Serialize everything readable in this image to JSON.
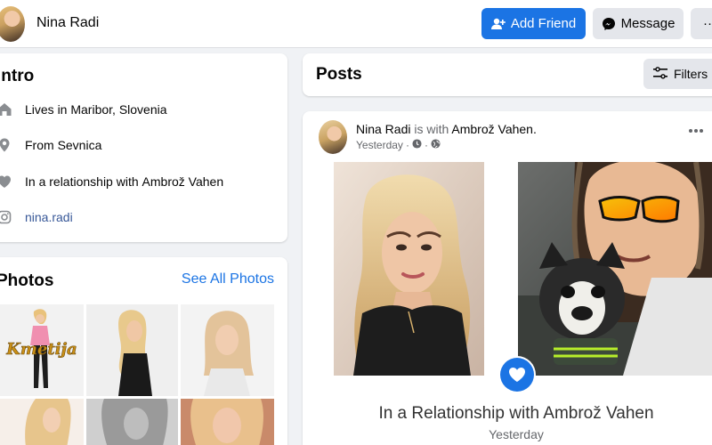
{
  "header": {
    "name": "Nina Radi",
    "add_friend_label": "Add Friend",
    "message_label": "Message",
    "more_label": "···"
  },
  "intro": {
    "title": "Intro",
    "items": [
      {
        "icon": "home-icon",
        "prefix": "Lives in ",
        "value": "Maribor, Slovenia"
      },
      {
        "icon": "location-pin-icon",
        "prefix": "From ",
        "value": "Sevnica"
      },
      {
        "icon": "heart-icon",
        "prefix": "In a relationship with ",
        "value": "Ambrož Vahen"
      },
      {
        "icon": "instagram-icon",
        "prefix": "",
        "value": "nina.radi"
      }
    ]
  },
  "photos": {
    "title": "Photos",
    "see_all_label": "See All Photos",
    "first_thumb_caption": "Kmetija"
  },
  "posts": {
    "title": "Posts",
    "filters_label": "Filters"
  },
  "post": {
    "author": "Nina Radi",
    "with_text": " is with ",
    "tagged": "Ambrož Vahen",
    "period": ".",
    "time": "Yesterday",
    "separator": "·",
    "relationship_text": "In a Relationship with Ambrož Vahen",
    "relationship_date": "Yesterday"
  },
  "colors": {
    "accent": "#1b74e4",
    "background": "#f0f2f5",
    "secondary_button": "#e4e6eb"
  }
}
